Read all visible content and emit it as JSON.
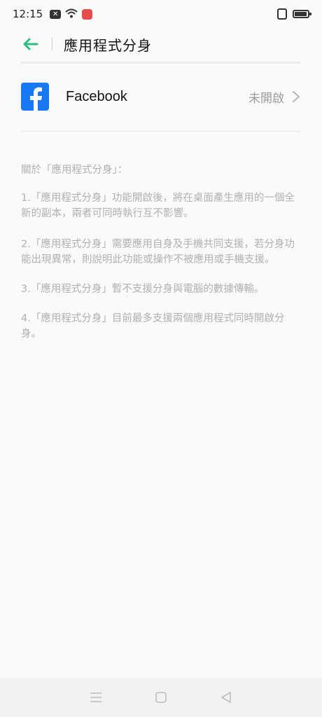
{
  "status_bar": {
    "time": "12:15",
    "icons": [
      "notification-x-icon",
      "wifi-icon",
      "app-notification-icon",
      "nfc-icon",
      "battery-icon"
    ]
  },
  "header": {
    "title": "應用程式分身",
    "back_icon": "arrow-left-icon",
    "accent_color": "#2ebd85"
  },
  "app_list": [
    {
      "name": "Facebook",
      "status": "未開啟",
      "icon": "facebook-icon",
      "icon_color": "#1877f2"
    }
  ],
  "info": {
    "heading": "關於「應用程式分身」：",
    "items": [
      "1.「應用程式分身」功能開啟後，將在桌面產生應用的一個全新的副本，兩者可同時執行互不影響。",
      "2.「應用程式分身」需要應用自身及手機共同支援，若分身功能出現異常，則說明此功能或操作不被應用或手機支援。",
      "3.「應用程式分身」暫不支援分身與電腦的數據傳輸。",
      "4.「應用程式分身」目前最多支援兩個應用程式同時開啟分身。"
    ]
  },
  "nav_bar": {
    "buttons": [
      "menu-icon",
      "home-icon",
      "back-triangle-icon"
    ]
  }
}
